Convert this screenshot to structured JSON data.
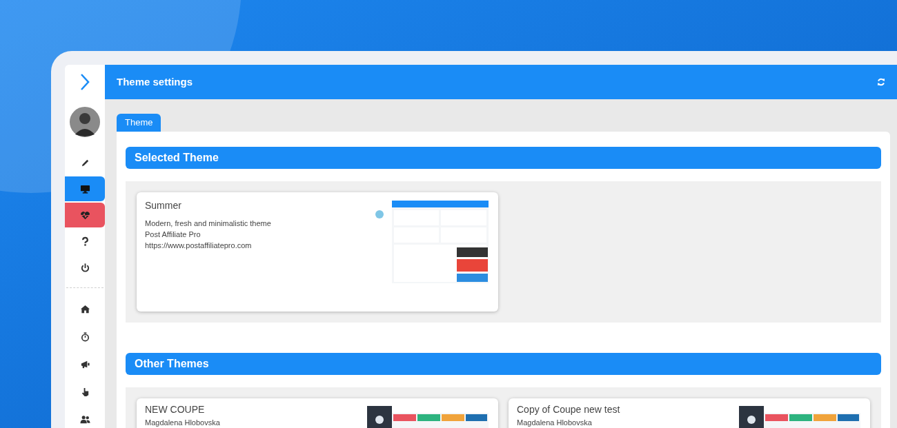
{
  "sidebar": {
    "items": [
      {
        "selected": false,
        "alert": false
      },
      {
        "selected": true,
        "alert": false
      },
      {
        "selected": false,
        "alert": true
      },
      {
        "selected": false,
        "alert": false
      },
      {
        "selected": false,
        "alert": false
      },
      {
        "selected": false,
        "alert": false
      },
      {
        "selected": false,
        "alert": false
      },
      {
        "selected": false,
        "alert": false
      },
      {
        "selected": false,
        "alert": false
      },
      {
        "selected": false,
        "alert": false
      }
    ]
  },
  "header": {
    "title": "Theme settings"
  },
  "tabs": [
    {
      "label": "Theme",
      "selected": true
    }
  ],
  "selected_theme": {
    "title": "Selected Theme",
    "themes": [
      {
        "name": "Summer",
        "lines": [
          "Modern, fresh and minimalistic theme",
          "Post Affiliate Pro",
          "https://www.postaffiliatepro.com"
        ]
      }
    ]
  },
  "other_themes": {
    "title": "Other Themes",
    "themes": [
      {
        "name": "NEW COUPE",
        "lines": [
          "Magdalena Hlobovska"
        ]
      },
      {
        "name": "Copy of Coupe new test",
        "lines": [
          "Magdalena Hlobovska"
        ]
      }
    ]
  }
}
